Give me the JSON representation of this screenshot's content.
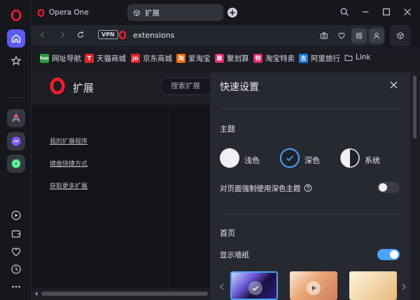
{
  "tabbar": {
    "app_tab_label": "Opera One",
    "active_tab_label": "扩展",
    "new_tab_symbol": "+"
  },
  "address": {
    "vpn_label": "VPN",
    "url": "extensions"
  },
  "bookmarks": [
    {
      "label": "网址导航",
      "icon_text": "hao",
      "color": "#2e9b3c"
    },
    {
      "label": "天猫商城",
      "icon_text": "T",
      "color": "#e0262c"
    },
    {
      "label": "京东商城",
      "icon_text": "JD",
      "color": "#e0262c"
    },
    {
      "label": "爱淘宝",
      "icon_text": "淘",
      "color": "#ff6a00"
    },
    {
      "label": "聚划算",
      "icon_text": "聚",
      "color": "#e6246a"
    },
    {
      "label": "淘宝特卖",
      "icon_text": "特",
      "color": "#e6246a"
    },
    {
      "label": "阿里旅行",
      "icon_text": "去",
      "color": "#1e7be0"
    },
    {
      "label": "Link",
      "icon_text": "",
      "color": "#cfd2d9"
    }
  ],
  "extensions": {
    "title": "扩展",
    "search_placeholder": "搜索扩展",
    "links": [
      "我的扩展程序",
      "键盘快捷方式",
      "获取更多扩展"
    ]
  },
  "quick_settings": {
    "title": "快速设置",
    "theme_heading": "主题",
    "themes": [
      {
        "label": "浅色",
        "selected": false
      },
      {
        "label": "深色",
        "selected": true
      },
      {
        "label": "系统",
        "selected": false
      }
    ],
    "force_dark_label": "对页面强制使用深色主题",
    "force_dark_on": false,
    "home_heading": "首页",
    "wallpaper_label": "显示墙纸",
    "wallpaper_on": true
  },
  "colors": {
    "accent": "#4aa3ff",
    "opera_red": "#ff1b2d",
    "sidebar_active": "#5b5cf0"
  }
}
